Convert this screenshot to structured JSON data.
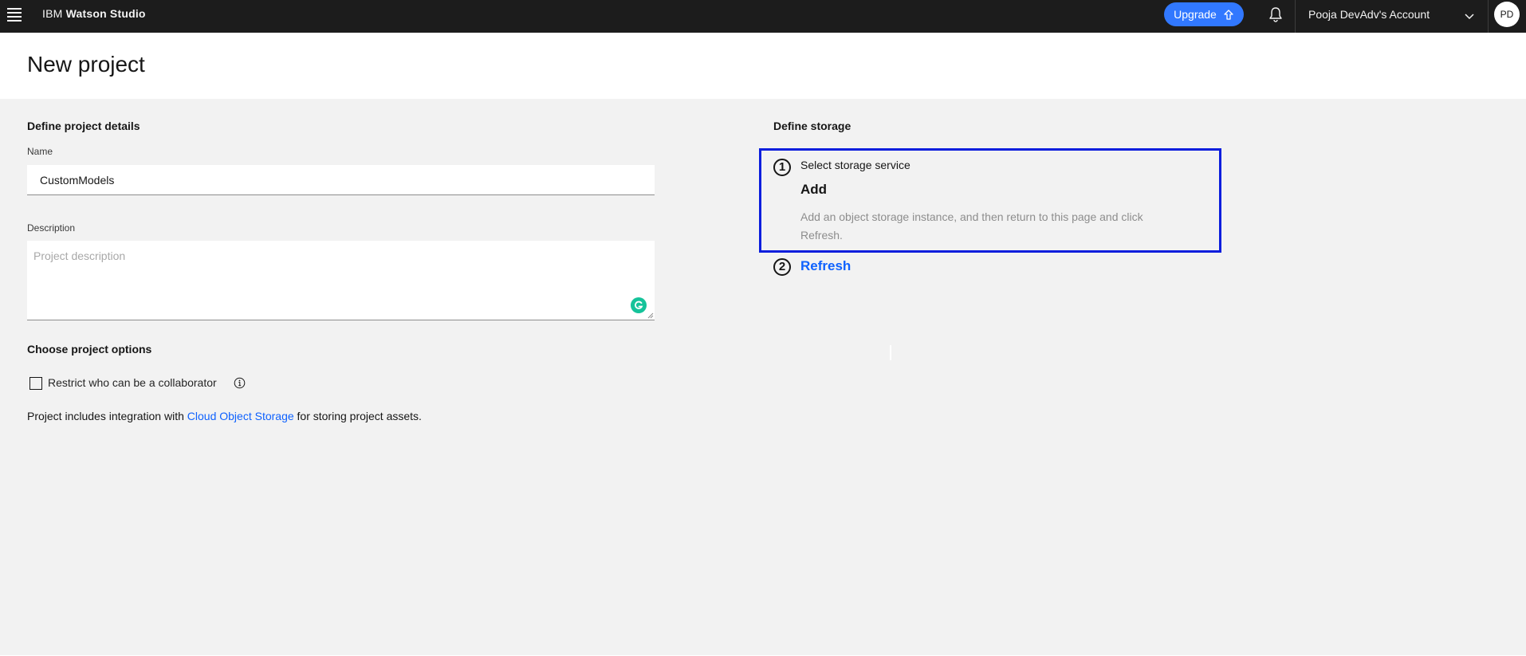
{
  "topbar": {
    "brand_prefix": "IBM ",
    "brand_name": "Watson Studio",
    "upgrade_label": "Upgrade",
    "account_label": "Pooja DevAdv's Account",
    "avatar_initials": "PD",
    "icons": [
      "menu-icon",
      "upload-arrow-icon",
      "bell-icon",
      "chevron-down-icon"
    ]
  },
  "header": {
    "title": "New project"
  },
  "details": {
    "section_title": "Define project details",
    "name_label": "Name",
    "name_value": "CustomModels",
    "description_label": "Description",
    "description_placeholder": "Project description",
    "description_value": ""
  },
  "options": {
    "section_title": "Choose project options",
    "restrict_label": "Restrict who can be a collaborator",
    "restrict_checked": false,
    "integration_prefix": "Project includes integration with ",
    "integration_link": "Cloud Object Storage",
    "integration_suffix": " for storing project assets."
  },
  "storage": {
    "section_title": "Define storage",
    "step1_number": "1",
    "step1_label": "Select storage service",
    "add_label": "Add",
    "add_description": "Add an object storage instance, and then return to this page and click Refresh.",
    "step2_number": "2",
    "refresh_label": "Refresh"
  },
  "colors": {
    "topbar_bg": "#1c1c1c",
    "accent_blue": "#0f62fe",
    "upgrade_blue": "#3178ff",
    "highlight_border": "#0b1edd",
    "grammarly_green": "#15c39a"
  }
}
